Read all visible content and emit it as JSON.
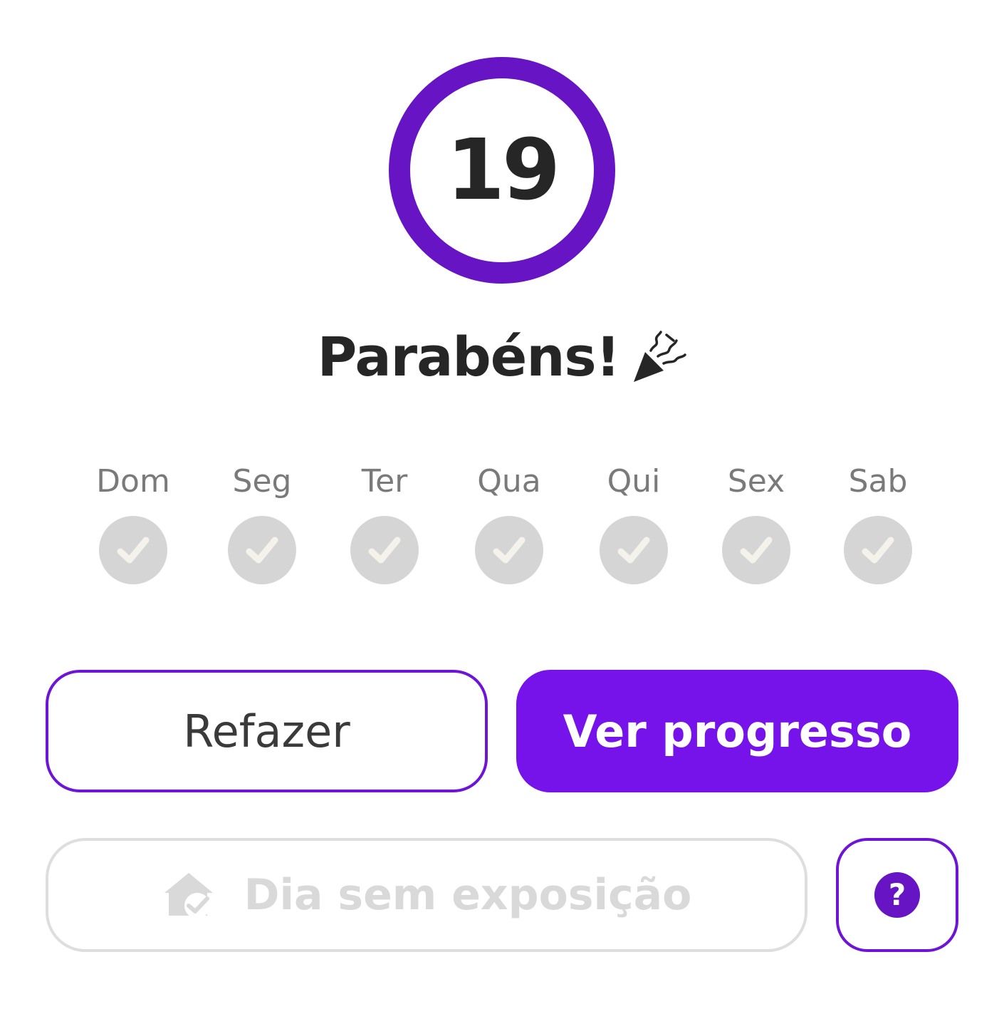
{
  "streak": {
    "count": "19",
    "ring_color": "#6714c4"
  },
  "header": {
    "title": "Parabéns!",
    "title_icon": "party-popper-icon"
  },
  "week": {
    "days": [
      {
        "label": "Dom",
        "done": true
      },
      {
        "label": "Seg",
        "done": true
      },
      {
        "label": "Ter",
        "done": true
      },
      {
        "label": "Qua",
        "done": true
      },
      {
        "label": "Qui",
        "done": true
      },
      {
        "label": "Sex",
        "done": true
      },
      {
        "label": "Sab",
        "done": true
      }
    ],
    "check_icon": "check-icon",
    "check_bg": "#d5d5d5"
  },
  "actions": {
    "redo_label": "Refazer",
    "progress_label": "Ver progresso",
    "exposure_label": "Dia sem exposição",
    "exposure_icon": "house-check-icon",
    "help_icon": "question-icon",
    "help_symbol": "?",
    "primary_color": "#7612ea"
  }
}
